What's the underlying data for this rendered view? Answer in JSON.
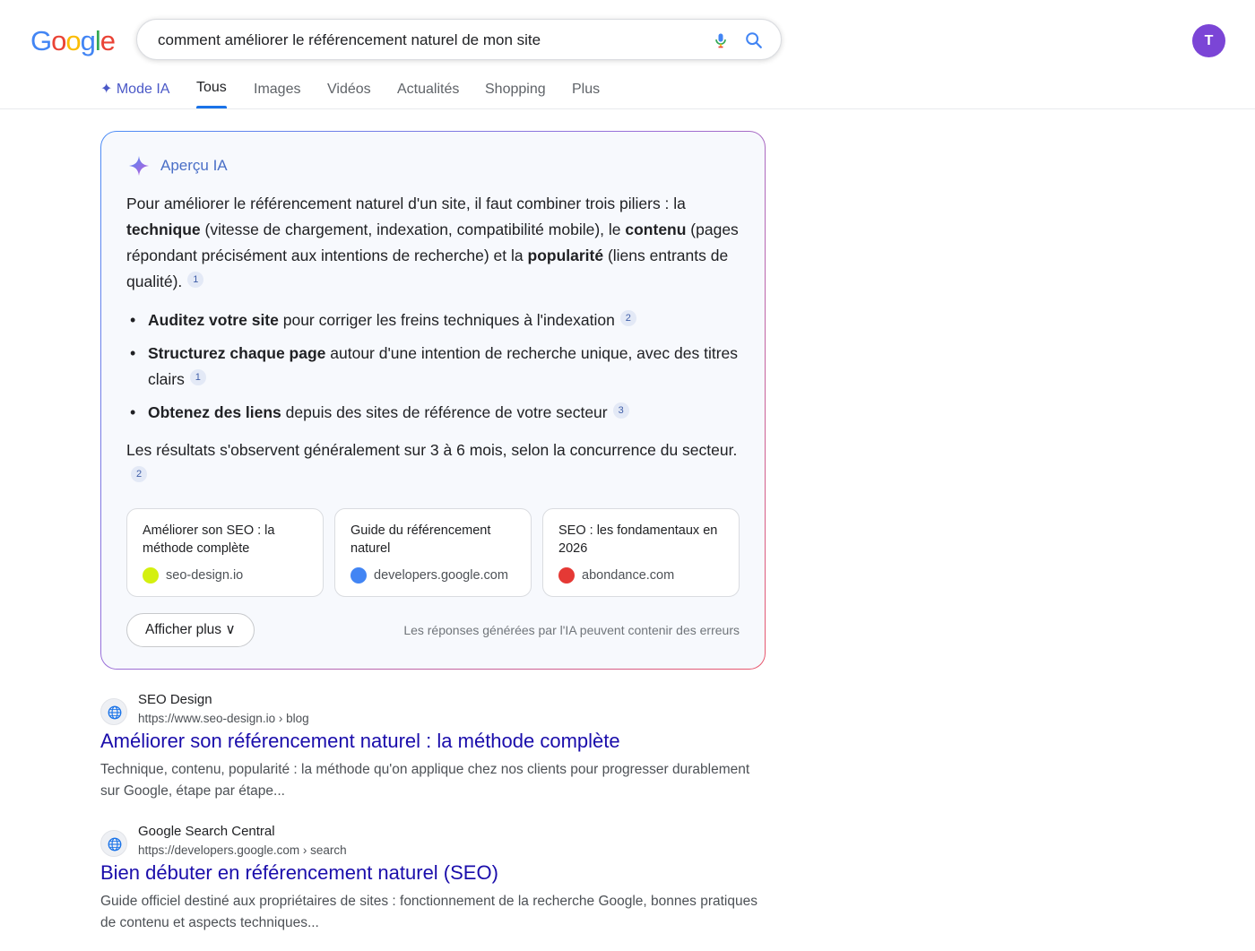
{
  "logo": {
    "letters": [
      "G",
      "o",
      "o",
      "g",
      "l",
      "e"
    ],
    "colors": [
      "#4285F4",
      "#EA4335",
      "#FBBC05",
      "#4285F4",
      "#34A853",
      "#EA4335"
    ]
  },
  "search": {
    "query": "comment améliorer le référencement naturel de mon site"
  },
  "user": {
    "avatar_letter": "T",
    "avatar_color": "#7b45d6"
  },
  "tabs": [
    {
      "label": "✦ Mode IA"
    },
    {
      "label": "Tous",
      "active": true
    },
    {
      "label": "Images"
    },
    {
      "label": "Vidéos"
    },
    {
      "label": "Actualités"
    },
    {
      "label": "Shopping"
    },
    {
      "label": "Plus"
    }
  ],
  "ai_overview": {
    "title": "Aperçu IA",
    "intro": {
      "t1": "Pour améliorer le référencement naturel d'un site, il faut combiner trois piliers : la ",
      "b1": "technique",
      "t2": " (vitesse de chargement, indexation, compatibilité mobile), le ",
      "b2": "contenu",
      "t3": " (pages répondant précisément aux intentions de recherche) et la ",
      "b3": "popularité",
      "t4": " (liens entrants de qualité).",
      "cite": "1"
    },
    "bullets": [
      {
        "bold": "Auditez votre site",
        "text": " pour corriger les freins techniques à l'indexation",
        "cite": "2"
      },
      {
        "bold": "Structurez chaque page",
        "text": " autour d'une intention de recherche unique, avec des titres clairs",
        "cite": "1"
      },
      {
        "bold": "Obtenez des liens",
        "text": " depuis des sites de référence de votre secteur",
        "cite": "3"
      }
    ],
    "conclusion": {
      "text": "Les résultats s'observent généralement sur 3 à 6 mois, selon la concurrence du secteur.",
      "cite": "2"
    },
    "sources": [
      {
        "title": "Améliorer son SEO : la méthode complète",
        "site": "seo-design.io",
        "color": "#d4f00f"
      },
      {
        "title": "Guide du référencement naturel",
        "site": "developers.google.com",
        "color": "#4285F4"
      },
      {
        "title": "SEO : les fondamentaux en 2026",
        "site": "abondance.com",
        "color": "#e53935"
      }
    ],
    "show_more_label": "Afficher plus ∨",
    "disclaimer": "Les réponses générées par l'IA peuvent contenir des erreurs"
  },
  "results": [
    {
      "site_name": "SEO Design",
      "url": "https://www.seo-design.io › blog",
      "title": "Améliorer son référencement naturel : la méthode complète",
      "snippet": "Technique, contenu, popularité : la méthode qu'on applique chez nos clients pour progresser durablement sur Google, étape par étape..."
    },
    {
      "site_name": "Google Search Central",
      "url": "https://developers.google.com › search",
      "title": "Bien débuter en référencement naturel (SEO)",
      "snippet": "Guide officiel destiné aux propriétaires de sites : fonctionnement de la recherche Google, bonnes pratiques de contenu et aspects techniques..."
    }
  ]
}
